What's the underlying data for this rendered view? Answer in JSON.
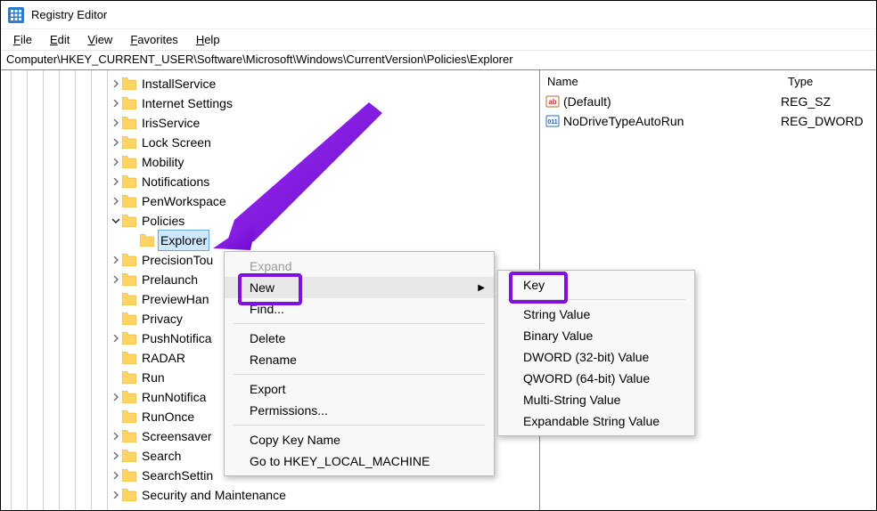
{
  "titlebar": {
    "title": "Registry Editor"
  },
  "menubar": {
    "items": [
      {
        "key": "F",
        "rest": "ile"
      },
      {
        "key": "E",
        "rest": "dit"
      },
      {
        "key": "V",
        "rest": "iew"
      },
      {
        "key": "F",
        "rest": "avorites"
      },
      {
        "key": "H",
        "rest": "elp"
      }
    ]
  },
  "addressbar": {
    "path": "Computer\\HKEY_CURRENT_USER\\Software\\Microsoft\\Windows\\CurrentVersion\\Policies\\Explorer"
  },
  "tree": {
    "items": [
      {
        "label": "InstallService",
        "chevron": "right"
      },
      {
        "label": "Internet Settings",
        "chevron": "right"
      },
      {
        "label": "IrisService",
        "chevron": "right"
      },
      {
        "label": "Lock Screen",
        "chevron": "right"
      },
      {
        "label": "Mobility",
        "chevron": "right"
      },
      {
        "label": "Notifications",
        "chevron": "right"
      },
      {
        "label": "PenWorkspace",
        "chevron": "right"
      },
      {
        "label": "Policies",
        "chevron": "down",
        "children": [
          {
            "label": "Explorer",
            "chevron": "none",
            "selected": true
          }
        ]
      },
      {
        "label": "PrecisionTouchPad",
        "chevron": "right",
        "truncated": "PrecisionTou"
      },
      {
        "label": "Prelaunch",
        "chevron": "right"
      },
      {
        "label": "PreviewHandlers",
        "chevron": "none",
        "truncated": "PreviewHan"
      },
      {
        "label": "Privacy",
        "chevron": "none"
      },
      {
        "label": "PushNotifications",
        "chevron": "right",
        "truncated": "PushNotifica"
      },
      {
        "label": "RADAR",
        "chevron": "none"
      },
      {
        "label": "Run",
        "chevron": "none"
      },
      {
        "label": "RunNotifications",
        "chevron": "right",
        "truncated": "RunNotifica"
      },
      {
        "label": "RunOnce",
        "chevron": "none"
      },
      {
        "label": "Screensavers",
        "chevron": "right",
        "truncated": "Screensaver"
      },
      {
        "label": "Search",
        "chevron": "right"
      },
      {
        "label": "SearchSettings",
        "chevron": "right",
        "truncated": "SearchSettin"
      },
      {
        "label": "Security and Maintenance",
        "chevron": "right"
      }
    ]
  },
  "list": {
    "headers": {
      "name": "Name",
      "type": "Type"
    },
    "rows": [
      {
        "icon": "string",
        "name": "(Default)",
        "type": "REG_SZ"
      },
      {
        "icon": "dword",
        "name": "NoDriveTypeAutoRun",
        "type": "REG_DWORD"
      }
    ]
  },
  "context_menu_1": {
    "items": [
      {
        "label": "Expand",
        "state": "disabled"
      },
      {
        "label": "New",
        "state": "hover",
        "submenu": true
      },
      {
        "label": "Find...",
        "state": "normal"
      },
      {
        "sep": true
      },
      {
        "label": "Delete",
        "state": "normal"
      },
      {
        "label": "Rename",
        "state": "normal"
      },
      {
        "sep": true
      },
      {
        "label": "Export",
        "state": "normal"
      },
      {
        "label": "Permissions...",
        "state": "normal"
      },
      {
        "sep": true
      },
      {
        "label": "Copy Key Name",
        "state": "normal"
      },
      {
        "label": "Go to HKEY_LOCAL_MACHINE",
        "state": "normal"
      }
    ]
  },
  "context_menu_2": {
    "items": [
      {
        "label": "Key",
        "state": "normal"
      },
      {
        "sep": true
      },
      {
        "label": "String Value",
        "state": "normal"
      },
      {
        "label": "Binary Value",
        "state": "normal"
      },
      {
        "label": "DWORD (32-bit) Value",
        "state": "normal"
      },
      {
        "label": "QWORD (64-bit) Value",
        "state": "normal"
      },
      {
        "label": "Multi-String Value",
        "state": "normal"
      },
      {
        "label": "Expandable String Value",
        "state": "normal"
      }
    ]
  },
  "colors": {
    "accent_purple": "#7f10e0",
    "selection_bg": "#cde8ff"
  }
}
